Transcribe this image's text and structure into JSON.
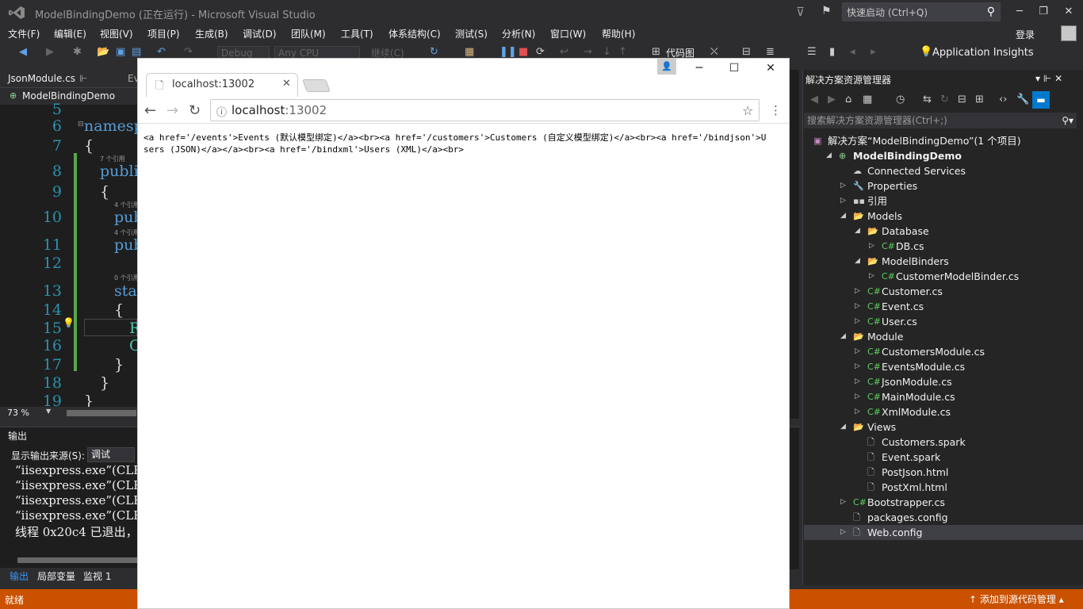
{
  "window": {
    "title": "ModelBindingDemo (正在运行) - Microsoft Visual Studio",
    "quick_launch_placeholder": "快速启动 (Ctrl+Q)",
    "minimize": "─",
    "maximize": "❐",
    "close": "✕"
  },
  "menu": {
    "items": [
      "文件(F)",
      "编辑(E)",
      "视图(V)",
      "项目(P)",
      "生成(B)",
      "调试(D)",
      "团队(M)",
      "工具(T)",
      "体系结构(C)",
      "测试(S)",
      "分析(N)",
      "窗口(W)",
      "帮助(H)"
    ],
    "login": "登录"
  },
  "toolbar": {
    "config": "Debug",
    "platform": "Any CPU",
    "continue": "继续(C)",
    "codemap": "代码图",
    "app_insights": "Application Insights"
  },
  "editor": {
    "tabs": [
      "JsonModule.cs",
      "Ev"
    ],
    "nav_project": "ModelBindingDemo",
    "line_numbers": [
      "5",
      "6",
      "7",
      "8",
      "9",
      "10",
      "11",
      "12",
      "13",
      "14",
      "15",
      "16",
      "17",
      "18",
      "19"
    ],
    "code": {
      "l6": "namesp",
      "l7": "{",
      "l8": "publi",
      "l9": "{",
      "l10": "pub",
      "l11": "pub",
      "l13": "stat",
      "l14": "{",
      "l15": "R",
      "l16": "C",
      "l17": "}",
      "l18": "}",
      "l19": "}"
    },
    "refs": {
      "r1": "7 个引用",
      "r2": "4 个引用",
      "r3": "4 个引用",
      "r4": "0 个引用"
    },
    "zoom": "73 %"
  },
  "output": {
    "title": "输出",
    "source_label": "显示输出来源(S):",
    "source_value": "调试",
    "lines": [
      "“iisexpress.exe”(CLR",
      "“iisexpress.exe”(CLR",
      "“iisexpress.exe”(CLR",
      "“iisexpress.exe”(CLR",
      "线程 0x20c4 已退出，"
    ],
    "tabs": [
      "输出",
      "局部变量",
      "监视 1"
    ]
  },
  "status": {
    "left": "就绪",
    "right": "↑ 添加到源代码管理 ▴"
  },
  "solution_explorer": {
    "title": "解决方案资源管理器",
    "search_placeholder": "搜索解决方案资源管理器(Ctrl+;)",
    "nodes": [
      {
        "label": "解决方案“ModelBindingDemo”(1 个项目)",
        "indent": 0,
        "arrow": "",
        "icon": "▣",
        "icon_color": "#c586c0",
        "bold": false
      },
      {
        "label": "ModelBindingDemo",
        "indent": 1,
        "arrow": "◢",
        "icon": "⊕",
        "icon_color": "#8fd18f",
        "bold": true
      },
      {
        "label": "Connected Services",
        "indent": 2,
        "arrow": "",
        "icon": "☁",
        "icon_color": "#ccc",
        "bold": false
      },
      {
        "label": "Properties",
        "indent": 2,
        "arrow": "▷",
        "icon": "🔧",
        "icon_color": "#ccc",
        "bold": false
      },
      {
        "label": "引用",
        "indent": 2,
        "arrow": "▷",
        "icon": "▪▪",
        "icon_color": "#ccc",
        "bold": false
      },
      {
        "label": "Models",
        "indent": 2,
        "arrow": "◢",
        "icon": "📂",
        "icon_color": "#dcb67a",
        "bold": false
      },
      {
        "label": "Database",
        "indent": 3,
        "arrow": "◢",
        "icon": "📂",
        "icon_color": "#dcb67a",
        "bold": false
      },
      {
        "label": "DB.cs",
        "indent": 4,
        "arrow": "▷",
        "icon": "C#",
        "icon_color": "#5fcf5f",
        "bold": false
      },
      {
        "label": "ModelBinders",
        "indent": 3,
        "arrow": "◢",
        "icon": "📂",
        "icon_color": "#dcb67a",
        "bold": false
      },
      {
        "label": "CustomerModelBinder.cs",
        "indent": 4,
        "arrow": "▷",
        "icon": "C#",
        "icon_color": "#5fcf5f",
        "bold": false
      },
      {
        "label": "Customer.cs",
        "indent": 3,
        "arrow": "▷",
        "icon": "C#",
        "icon_color": "#5fcf5f",
        "bold": false
      },
      {
        "label": "Event.cs",
        "indent": 3,
        "arrow": "▷",
        "icon": "C#",
        "icon_color": "#5fcf5f",
        "bold": false
      },
      {
        "label": "User.cs",
        "indent": 3,
        "arrow": "▷",
        "icon": "C#",
        "icon_color": "#5fcf5f",
        "bold": false
      },
      {
        "label": "Module",
        "indent": 2,
        "arrow": "◢",
        "icon": "📂",
        "icon_color": "#dcb67a",
        "bold": false
      },
      {
        "label": "CustomersModule.cs",
        "indent": 3,
        "arrow": "▷",
        "icon": "C#",
        "icon_color": "#5fcf5f",
        "bold": false
      },
      {
        "label": "EventsModule.cs",
        "indent": 3,
        "arrow": "▷",
        "icon": "C#",
        "icon_color": "#5fcf5f",
        "bold": false
      },
      {
        "label": "JsonModule.cs",
        "indent": 3,
        "arrow": "▷",
        "icon": "C#",
        "icon_color": "#5fcf5f",
        "bold": false
      },
      {
        "label": "MainModule.cs",
        "indent": 3,
        "arrow": "▷",
        "icon": "C#",
        "icon_color": "#5fcf5f",
        "bold": false
      },
      {
        "label": "XmlModule.cs",
        "indent": 3,
        "arrow": "▷",
        "icon": "C#",
        "icon_color": "#5fcf5f",
        "bold": false
      },
      {
        "label": "Views",
        "indent": 2,
        "arrow": "◢",
        "icon": "📂",
        "icon_color": "#dcb67a",
        "bold": false
      },
      {
        "label": "Customers.spark",
        "indent": 3,
        "arrow": "",
        "icon": "🗋",
        "icon_color": "#ccc",
        "bold": false
      },
      {
        "label": "Event.spark",
        "indent": 3,
        "arrow": "",
        "icon": "🗋",
        "icon_color": "#ccc",
        "bold": false
      },
      {
        "label": "PostJson.html",
        "indent": 3,
        "arrow": "",
        "icon": "🗋",
        "icon_color": "#ccc",
        "bold": false
      },
      {
        "label": "PostXml.html",
        "indent": 3,
        "arrow": "",
        "icon": "🗋",
        "icon_color": "#ccc",
        "bold": false
      },
      {
        "label": "Bootstrapper.cs",
        "indent": 2,
        "arrow": "▷",
        "icon": "C#",
        "icon_color": "#5fcf5f",
        "bold": false
      },
      {
        "label": "packages.config",
        "indent": 2,
        "arrow": "",
        "icon": "🗋",
        "icon_color": "#ccc",
        "bold": false
      },
      {
        "label": "Web.config",
        "indent": 2,
        "arrow": "▷",
        "icon": "🗋",
        "icon_color": "#ccc",
        "bold": false,
        "selected": true
      }
    ]
  },
  "browser": {
    "tab_title": "localhost:13002",
    "url_host": "localhost",
    "url_port": ":13002",
    "content": "<a href='/events'>Events (默认模型绑定)</a><br><a href='/customers'>Customers (自定义模型绑定)</a><br><a href='/bindjson'>Users (JSON)</a></a><br><a href='/bindxml'>Users (XML)</a><br>"
  }
}
